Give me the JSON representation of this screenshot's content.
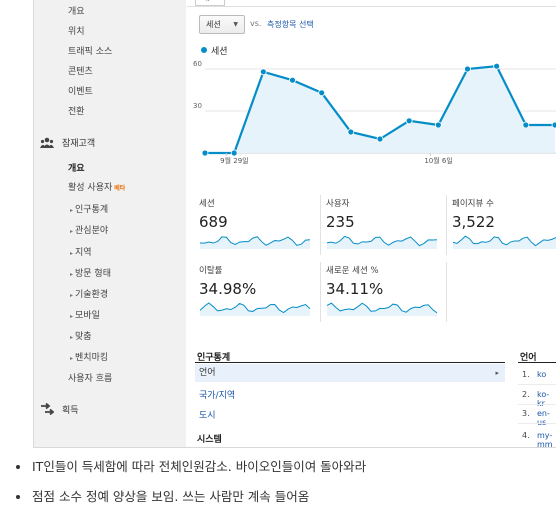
{
  "sidebar": {
    "top_items": [
      "개요",
      "위치",
      "트래픽 소스",
      "콘텐츠",
      "이벤트",
      "전환"
    ],
    "audience_title": "잠재고객",
    "audience_items": [
      {
        "label": "개요",
        "active": true
      },
      {
        "label": "활성 사용자",
        "badge": "베타"
      }
    ],
    "audience_sub": [
      "인구통계",
      "관심분야",
      "지역",
      "방문 형태",
      "기술환경",
      "모바일",
      "맞춤",
      "벤치마킹"
    ],
    "user_flow": "사용자 흐름",
    "acquisition_title": "획득"
  },
  "main": {
    "tab_label": "개요",
    "metric_select": "세션",
    "vs_text": "vs.",
    "select_metric_link": "측정항목 선택",
    "legend_label": "세션",
    "accent": "#058dc7"
  },
  "chart_data": {
    "type": "area",
    "series": [
      {
        "name": "세션",
        "values": [
          0,
          0,
          58,
          52,
          43,
          15,
          10,
          23,
          20,
          60,
          62,
          20,
          20
        ]
      }
    ],
    "yticks": [
      "60",
      "30"
    ],
    "ylim": [
      0,
      70
    ],
    "xlabels": [
      "9월 29일",
      "10월 6일"
    ],
    "color": "#058dc7"
  },
  "metrics": [
    {
      "label": "세션",
      "value": "689"
    },
    {
      "label": "사용자",
      "value": "235"
    },
    {
      "label": "페이지뷰 수",
      "value": "3,522"
    },
    {
      "label": "이탈률",
      "value": "34.98%"
    },
    {
      "label": "새로운 세션 %",
      "value": "34.11%"
    }
  ],
  "demographics": {
    "header": "인구통계",
    "rows": [
      {
        "label": "언어",
        "selected": true
      },
      {
        "label": "국가/지역"
      },
      {
        "label": "도시"
      }
    ],
    "system_header": "시스템"
  },
  "language_table": {
    "header": "언어",
    "rows": [
      {
        "index": "1.",
        "value": "ko"
      },
      {
        "index": "2.",
        "value": "ko-kr"
      },
      {
        "index": "3.",
        "value": "en-us"
      },
      {
        "index": "4.",
        "value": "my-mm"
      }
    ]
  },
  "notes": [
    "IT인들이 득세함에 따라 전체인원감소. 바이오인들이여 돌아와라",
    "점점 소수 정예 양상을 보임. 쓰는 사람만 계속 들어옴"
  ]
}
